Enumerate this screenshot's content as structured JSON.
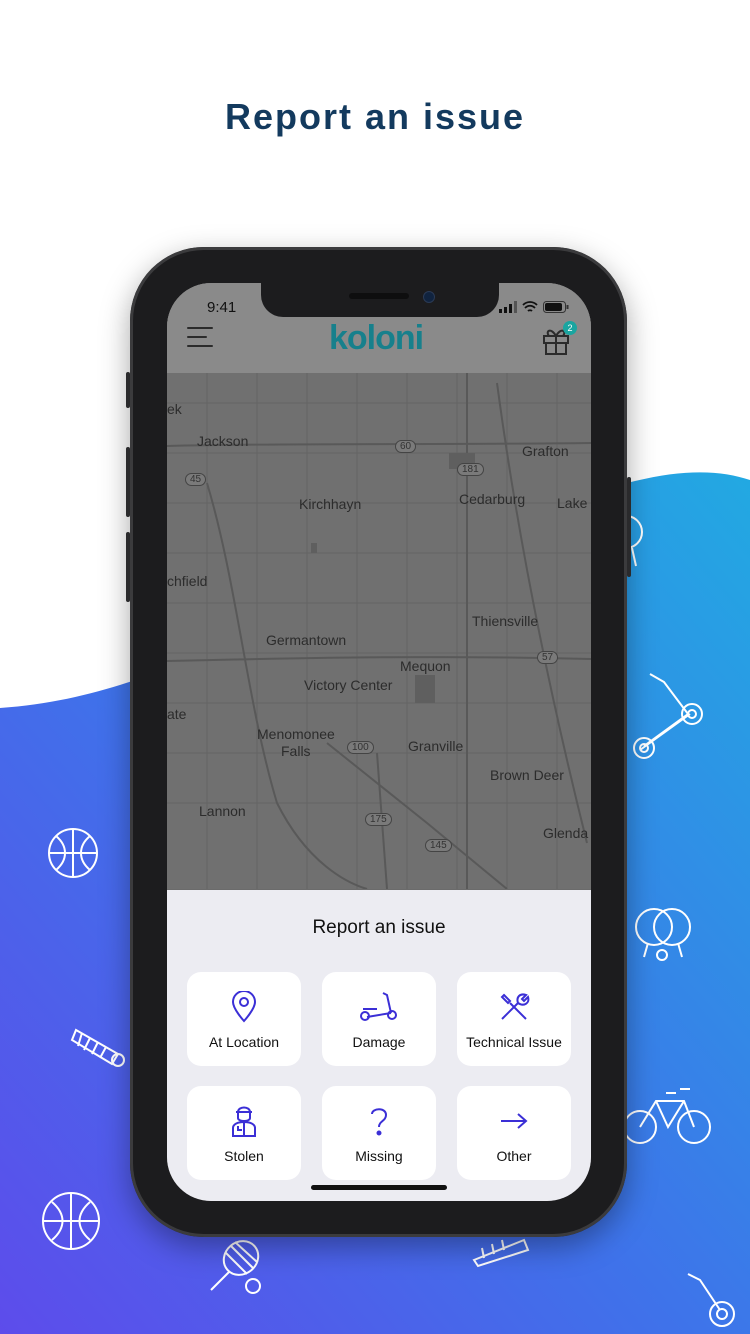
{
  "headline": "Report an issue",
  "colors": {
    "headline": "#133a5e",
    "gradient_top": "#22a7e0",
    "gradient_bottom": "#5b4ee8",
    "brand_teal": "#17808c",
    "icon_purple": "#3b2fd6"
  },
  "phone": {
    "status_time": "9:41",
    "app_logo": "koloni",
    "gift_badge_count": "2"
  },
  "map": {
    "labels": [
      "Jackson",
      "Grafton",
      "Kirchhayn",
      "Cedarburg",
      "Lake",
      "chfield",
      "Thiensville",
      "Germantown",
      "Mequon",
      "Victory Center",
      "ate",
      "Menomonee",
      "Falls",
      "Granville",
      "Brown Deer",
      "Lannon",
      "Glenda",
      "ek"
    ],
    "highway_shields": [
      "60",
      "181",
      "45",
      "57",
      "100",
      "175",
      "145"
    ]
  },
  "report_sheet": {
    "title": "Report an issue",
    "options": [
      {
        "label": "At Location",
        "icon": "map-pin-icon"
      },
      {
        "label": "Damage",
        "icon": "scooter-icon"
      },
      {
        "label": "Technical Issue",
        "icon": "wrench-screwdriver-icon"
      },
      {
        "label": "Stolen",
        "icon": "thief-icon"
      },
      {
        "label": "Missing",
        "icon": "question-mark-icon"
      },
      {
        "label": "Other",
        "icon": "arrow-right-icon"
      }
    ]
  },
  "decorations": [
    "basketball-icon",
    "shuttlecock-icon",
    "basketball-icon",
    "tennis-racket-icon",
    "scooter-icon",
    "ping-pong-icon",
    "bicycle-icon",
    "shuttlecock-icon",
    "scooter-icon"
  ]
}
